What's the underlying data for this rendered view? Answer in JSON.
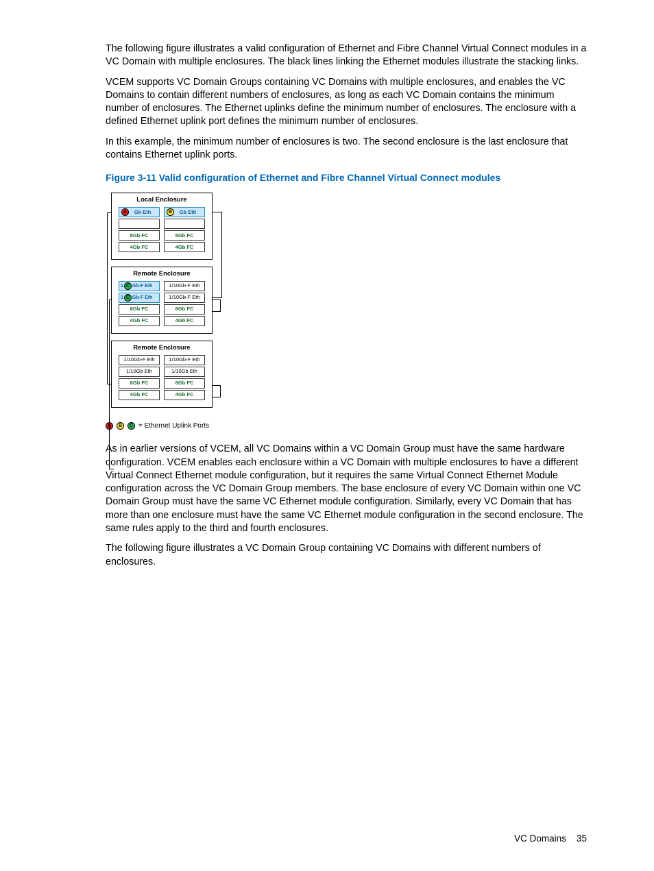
{
  "paragraphs": {
    "p1": "The following figure illustrates a valid configuration of Ethernet and Fibre Channel Virtual Connect modules in a VC Domain with multiple enclosures. The black lines linking the Ethernet modules illustrate the stacking links.",
    "p2": "VCEM supports VC Domain Groups containing VC Domains with multiple enclosures, and enables the VC Domains to contain different numbers of enclosures, as long as each VC Domain contains the minimum number of enclosures. The Ethernet uplinks define the minimum number of enclosures. The enclosure with a defined Ethernet uplink port defines the minimum number of enclosures.",
    "p3": "In this example, the minimum number of enclosures is two. The second enclosure is the last enclosure that contains Ethernet uplink ports.",
    "p4": "As in earlier versions of VCEM, all VC Domains within a VC Domain Group must have the same hardware configuration. VCEM enables each enclosure within a VC Domain with multiple enclosures to have a different Virtual Connect Ethernet module configuration, but it requires the same Virtual Connect Ethernet Module configuration across the VC Domain Group members. The base enclosure of every VC Domain within one VC Domain Group must have the same VC Ethernet module configuration. Similarly, every VC Domain that has more than one enclosure must have the same VC Ethernet module configuration in the second enclosure. The same rules apply to the third and fourth enclosures.",
    "p5": "The following figure illustrates a VC Domain Group containing VC Domains with different numbers of enclosures."
  },
  "figure": {
    "caption": "Figure 3-11 Valid configuration of Ethernet and Fibre Channel Virtual Connect modules",
    "legend_label": "= Ethernet Uplink Ports",
    "badges": {
      "a": "A",
      "b": "B",
      "c": "C"
    },
    "enclosures": [
      {
        "title": "Local Enclosure",
        "rows": [
          [
            {
              "type": "eth",
              "label": "Gb Eth",
              "badge": "A",
              "color": "red"
            },
            {
              "type": "eth",
              "label": "Gb Eth",
              "badge": "B",
              "color": "yel"
            }
          ],
          [
            {
              "type": "empty"
            },
            {
              "type": "empty"
            }
          ],
          [
            {
              "type": "fc",
              "label": "8Gb FC"
            },
            {
              "type": "fc",
              "label": "8Gb FC"
            }
          ],
          [
            {
              "type": "fc",
              "label": "4Gb FC"
            },
            {
              "type": "fc",
              "label": "4Gb FC"
            }
          ]
        ]
      },
      {
        "title": "Remote Enclosure",
        "rows": [
          [
            {
              "type": "eth",
              "label": "Gb-F Eth",
              "badge": "C",
              "color": "grn",
              "prefix": "1"
            },
            {
              "type": "plain",
              "label": "1/10Gb-F Eth"
            }
          ],
          [
            {
              "type": "eth",
              "label": "Gb-F Eth",
              "badge": "C",
              "color": "grn",
              "prefix": "1"
            },
            {
              "type": "plain",
              "label": "1/10Gb-F Eth"
            }
          ],
          [
            {
              "type": "fc",
              "label": "8Gb FC"
            },
            {
              "type": "fc",
              "label": "8Gb FC"
            }
          ],
          [
            {
              "type": "fc",
              "label": "4Gb FC"
            },
            {
              "type": "fc",
              "label": "4Gb FC"
            }
          ]
        ]
      },
      {
        "title": "Remote Enclosure",
        "rows": [
          [
            {
              "type": "plain",
              "label": "1/10Gb-F Eth"
            },
            {
              "type": "plain",
              "label": "1/10Gb-F Eth"
            }
          ],
          [
            {
              "type": "plain",
              "label": "1/10Gb Eth"
            },
            {
              "type": "plain",
              "label": "1/10Gb Eth"
            }
          ],
          [
            {
              "type": "fc",
              "label": "8Gb FC"
            },
            {
              "type": "fc",
              "label": "8Gb FC"
            }
          ],
          [
            {
              "type": "fc",
              "label": "4Gb FC"
            },
            {
              "type": "fc",
              "label": "4Gb FC"
            }
          ]
        ]
      }
    ]
  },
  "footer": {
    "section": "VC Domains",
    "page": "35"
  }
}
